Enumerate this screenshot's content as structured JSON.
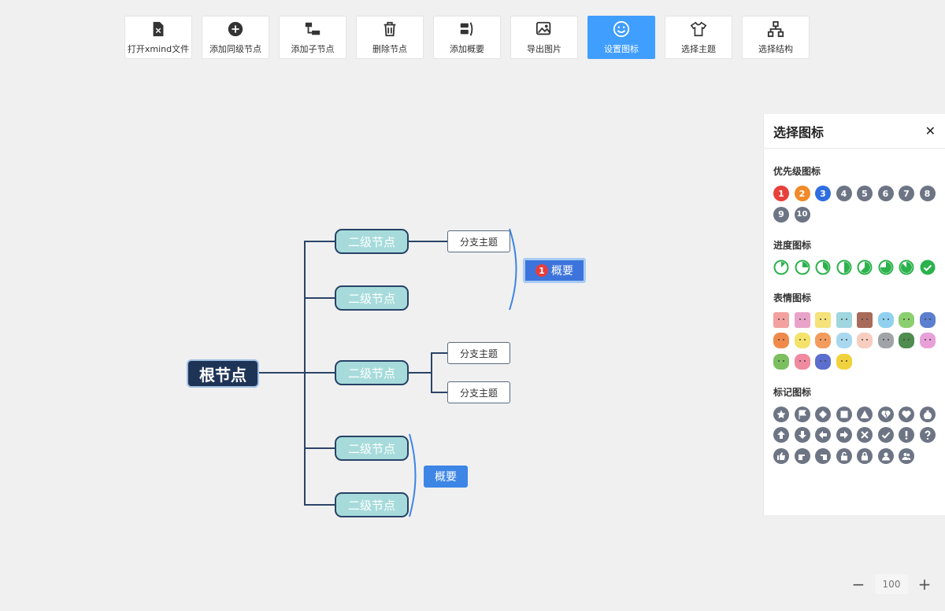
{
  "toolbar": {
    "items": [
      {
        "label": "打开xmind文件",
        "icon": "xmind-file-icon"
      },
      {
        "label": "添加同级节点",
        "icon": "add-circle-icon"
      },
      {
        "label": "添加子节点",
        "icon": "add-child-icon"
      },
      {
        "label": "删除节点",
        "icon": "trash-icon"
      },
      {
        "label": "添加概要",
        "icon": "summary-icon"
      },
      {
        "label": "导出图片",
        "icon": "export-image-icon"
      },
      {
        "label": "设置图标",
        "icon": "smile-icon",
        "active": true
      },
      {
        "label": "选择主题",
        "icon": "tshirt-icon"
      },
      {
        "label": "选择结构",
        "icon": "structure-icon"
      }
    ]
  },
  "mindmap": {
    "root": "根节点",
    "level2": [
      "二级节点",
      "二级节点",
      "二级节点",
      "二级节点",
      "二级节点"
    ],
    "branches": [
      "分支主题",
      "分支主题",
      "分支主题"
    ],
    "summary_top": {
      "badge": "1",
      "label": "概要"
    },
    "summary_bottom": "概要"
  },
  "panel": {
    "title": "选择图标",
    "close": "✕",
    "priority": {
      "title": "优先级图标",
      "items": [
        "1",
        "2",
        "3",
        "4",
        "5",
        "6",
        "7",
        "8",
        "9",
        "10"
      ],
      "colors": [
        "#e8403a",
        "#f08a2a",
        "#2f6de0",
        "#6d7585",
        "#6d7585",
        "#6d7585",
        "#6d7585",
        "#6d7585",
        "#6d7585",
        "#6d7585"
      ]
    },
    "progress": {
      "title": "进度图标",
      "items": [
        0.125,
        0.25,
        0.375,
        0.5,
        0.625,
        0.75,
        0.875,
        1.0
      ],
      "color": "#2bb24c"
    },
    "emotion": {
      "title": "表情图标",
      "colors": [
        "#f3a0a0",
        "#e9a3c9",
        "#f5e27a",
        "#9fd6e0",
        "#a86b5a",
        "#8fd1ef",
        "#8bcf6f",
        "#5c7fcf",
        "#f08a4b",
        "#f4e26a",
        "#f39c5e",
        "#a8d8f0",
        "#f7cdbf",
        "#a0a4a8",
        "#4f8c4f",
        "#e8a0d8",
        "#7bbf5f",
        "#f08aa0",
        "#5c6fcf",
        "#f2d23c"
      ]
    },
    "marks": {
      "title": "标记图标",
      "items": [
        "star-icon",
        "flag-icon",
        "diamond-icon",
        "square-icon",
        "triangle-icon",
        "broken-heart-icon",
        "heart-icon",
        "money-bag-icon",
        "arrow-up-icon",
        "arrow-down-icon",
        "arrow-left-icon",
        "arrow-right-icon",
        "cross-icon",
        "check-icon",
        "exclamation-icon",
        "question-icon",
        "thumbs-up-icon",
        "hand-point-icon",
        "hand-left-icon",
        "unlock-icon",
        "lock-icon",
        "user-icon",
        "users-icon"
      ]
    }
  },
  "zoom": {
    "minus": "−",
    "value": "100",
    "plus": "+"
  }
}
